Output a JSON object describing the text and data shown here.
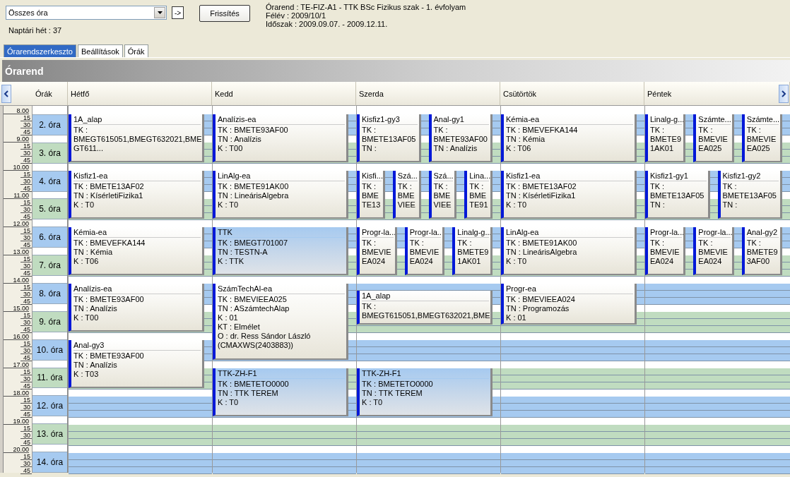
{
  "filter": {
    "value": "Összes óra",
    "go_button": "->"
  },
  "week": "Naptári hét : 37",
  "refresh_button": "Frissítés",
  "info": [
    "Órarend : TE-FIZ-A1 - TTK BSc Fizikus szak - 1. évfolyam",
    "Félév : 2009/10/1",
    "Időszak : 2009.09.07. - 2009.12.11."
  ],
  "tabs": [
    {
      "label": "Órarendszerkeszto",
      "selected": true
    },
    {
      "label": "Beállítások",
      "selected": false
    },
    {
      "label": "Órák",
      "selected": false
    }
  ],
  "panel_title": "Órarend",
  "periods_header": "Órák",
  "hours": [
    {
      "label": "8.00",
      "marks": [
        "15",
        "30",
        "45"
      ]
    },
    {
      "label": "9.00",
      "marks": [
        "15",
        "30",
        "45"
      ]
    },
    {
      "label": "10.00",
      "marks": [
        "15",
        "30",
        "45"
      ]
    },
    {
      "label": "11.00",
      "marks": [
        "15",
        "30",
        "45"
      ]
    },
    {
      "label": "12.00",
      "marks": [
        "15",
        "30",
        "45"
      ]
    },
    {
      "label": "13.00",
      "marks": [
        "15",
        "30",
        "45"
      ]
    },
    {
      "label": "14.00",
      "marks": [
        "15",
        "30",
        "45"
      ]
    },
    {
      "label": "15.00",
      "marks": [
        "15",
        "30",
        "45"
      ]
    },
    {
      "label": "16.00",
      "marks": [
        "15",
        "30",
        "45"
      ]
    },
    {
      "label": "17.00",
      "marks": [
        "15",
        "30",
        "45"
      ]
    },
    {
      "label": "18.00",
      "marks": [
        "15",
        "30",
        "45"
      ]
    },
    {
      "label": "19.00",
      "marks": [
        "15",
        "30",
        "45"
      ]
    },
    {
      "label": "20.00",
      "marks": [
        "15",
        "30",
        "45"
      ]
    }
  ],
  "periods": [
    {
      "label": "2. óra",
      "color": "#a6caf0"
    },
    {
      "label": "3. óra",
      "color": "#c0dcc0"
    },
    {
      "label": "4. óra",
      "color": "#a6caf0"
    },
    {
      "label": "5. óra",
      "color": "#c0dcc0"
    },
    {
      "label": "6. óra",
      "color": "#a6caf0"
    },
    {
      "label": "7. óra",
      "color": "#c0dcc0"
    },
    {
      "label": "8. óra",
      "color": "#a6caf0"
    },
    {
      "label": "9. óra",
      "color": "#c0dcc0"
    },
    {
      "label": "10. óra",
      "color": "#a6caf0"
    },
    {
      "label": "11. óra",
      "color": "#c0dcc0"
    },
    {
      "label": "12. óra",
      "color": "#a6caf0"
    },
    {
      "label": "13. óra",
      "color": "#c0dcc0"
    },
    {
      "label": "14. óra",
      "color": "#a6caf0"
    }
  ],
  "days": [
    {
      "name": "Hétfő",
      "groups": [
        {
          "events": [
            {
              "title": "1A_alap",
              "highlighted": false,
              "lines": [
                "TK :",
                "BMEGT615051,BMEGT632021,BME",
                "GT611..."
              ]
            }
          ]
        },
        {
          "events": [
            {
              "title": "Kisfiz1-ea",
              "highlighted": false,
              "lines": [
                "TK : BMETE13AF02",
                "TN : KísérletiFizika1",
                "K : T0"
              ]
            }
          ]
        },
        {
          "events": [
            {
              "title": "Kémia-ea",
              "highlighted": false,
              "lines": [
                "TK : BMEVEFKA144",
                "TN : Kémia",
                "K : T06"
              ]
            }
          ]
        },
        {
          "events": [
            {
              "title": "Analízis-ea",
              "highlighted": false,
              "lines": [
                "TK : BMETE93AF00",
                "TN : Analízis",
                "K : T00"
              ]
            }
          ]
        },
        {
          "events": [
            {
              "title": "Anal-gy3",
              "highlighted": false,
              "lines": [
                "TK : BMETE93AF00",
                "TN : Analízis",
                "K : T03"
              ]
            }
          ]
        }
      ]
    },
    {
      "name": "Kedd",
      "groups": [
        {
          "events": [
            {
              "title": "Analízis-ea",
              "highlighted": false,
              "lines": [
                "TK : BMETE93AF00",
                "TN : Analízis",
                "K : T00"
              ]
            }
          ]
        },
        {
          "events": [
            {
              "title": "LinAlg-ea",
              "highlighted": false,
              "lines": [
                "TK : BMETE91AK00",
                "TN : LineárisAlgebra",
                "K : T0"
              ]
            }
          ]
        },
        {
          "events": [
            {
              "title": "TTK",
              "highlighted": true,
              "lines": [
                "TK : BMEGT701007",
                "TN : TESTN-A",
                "K : TTK"
              ]
            }
          ]
        },
        {
          "events": [
            {
              "title": "SzámTechAl-ea",
              "highlighted": false,
              "lines": [
                "TK : BMEVIEEA025",
                "TN : ASzámtechAlap",
                "K : 01",
                "KT : Elmélet",
                "O :  dr. Ress Sándor László",
                "(CMAXWS(2403883))"
              ]
            }
          ]
        },
        {
          "events": [
            {
              "title": "TTK-ZH-F1",
              "highlighted": true,
              "lines": [
                "TK : BMETETO0000",
                "TN : TTK TEREM",
                "K : T0"
              ]
            }
          ]
        }
      ]
    },
    {
      "name": "Szerda",
      "groups": [
        {
          "events": [
            {
              "title": "Kisfiz1-gy3",
              "highlighted": false,
              "lines": [
                "TK :",
                "BMETE13AF05",
                "TN :"
              ]
            },
            {
              "title": "Anal-gy1",
              "highlighted": false,
              "lines": [
                "TK :",
                "BMETE93AF00",
                "TN : Analízis"
              ]
            }
          ]
        },
        {
          "events": [
            {
              "title": "Kisfi...",
              "highlighted": false,
              "lines": [
                "TK :",
                "BME",
                "TE13"
              ]
            },
            {
              "title": "Szá...",
              "highlighted": false,
              "lines": [
                "TK :",
                "BME",
                "VIEE"
              ]
            },
            {
              "title": "Szá...",
              "highlighted": false,
              "lines": [
                "TK :",
                "BME",
                "VIEE"
              ]
            },
            {
              "title": "Lina...",
              "highlighted": false,
              "lines": [
                "TK :",
                "BME",
                "TE91"
              ]
            }
          ]
        },
        {
          "events": [
            {
              "title": "Progr-la...",
              "highlighted": false,
              "lines": [
                "TK :",
                "BMEVIE",
                "EA024"
              ]
            },
            {
              "title": "Progr-la...",
              "highlighted": false,
              "lines": [
                "TK :",
                "BMEVIE",
                "EA024"
              ]
            },
            {
              "title": "Linalg-g...",
              "highlighted": false,
              "lines": [
                "TK :",
                "BMETE9",
                "1AK01"
              ]
            }
          ]
        },
        {
          "events": [
            {
              "title": "1A_alap",
              "highlighted": false,
              "lines": [
                "TK :",
                "BMEGT615051,BMEGT632021,BME"
              ]
            }
          ]
        },
        {
          "events": [
            {
              "title": "TTK-ZH-F1",
              "highlighted": true,
              "lines": [
                "TK : BMETETO0000",
                "TN : TTK TEREM",
                "K : T0"
              ]
            }
          ]
        }
      ]
    },
    {
      "name": "Csütörtök",
      "groups": [
        {
          "events": [
            {
              "title": "Kémia-ea",
              "highlighted": false,
              "lines": [
                "TK : BMEVEFKA144",
                "TN : Kémia",
                "K : T06"
              ]
            }
          ]
        },
        {
          "events": [
            {
              "title": "Kisfiz1-ea",
              "highlighted": false,
              "lines": [
                "TK : BMETE13AF02",
                "TN : KísérletiFizika1",
                "K : T0"
              ]
            }
          ]
        },
        {
          "events": [
            {
              "title": "LinAlg-ea",
              "highlighted": false,
              "lines": [
                "TK : BMETE91AK00",
                "TN : LineárisAlgebra",
                "K : T0"
              ]
            }
          ]
        },
        {
          "events": [
            {
              "title": "Progr-ea",
              "highlighted": false,
              "lines": [
                "TK : BMEVIEEA024",
                "TN : Programozás",
                "K : 01"
              ]
            }
          ]
        }
      ]
    },
    {
      "name": "Péntek",
      "groups": [
        {
          "events": [
            {
              "title": "Linalg-g...",
              "highlighted": false,
              "lines": [
                "TK :",
                "BMETE9",
                "1AK01"
              ]
            },
            {
              "title": "Számte...",
              "highlighted": false,
              "lines": [
                "TK :",
                "BMEVIE",
                "EA025"
              ]
            },
            {
              "title": "Számte...",
              "highlighted": false,
              "lines": [
                "TK :",
                "BMEVIE",
                "EA025"
              ]
            }
          ]
        },
        {
          "events": [
            {
              "title": "Kisfiz1-gy1",
              "highlighted": false,
              "lines": [
                "TK :",
                "BMETE13AF05",
                "TN :"
              ]
            },
            {
              "title": "Kisfiz1-gy2",
              "highlighted": false,
              "lines": [
                "TK :",
                "BMETE13AF05",
                "TN :"
              ]
            }
          ]
        },
        {
          "events": [
            {
              "title": "Progr-la...",
              "highlighted": false,
              "lines": [
                "TK :",
                "BMEVIE",
                "EA024"
              ]
            },
            {
              "title": "Progr-la...",
              "highlighted": false,
              "lines": [
                "TK :",
                "BMEVIE",
                "EA024"
              ]
            },
            {
              "title": "Anal-gy2",
              "highlighted": false,
              "lines": [
                "TK :",
                "BMETE9",
                "3AF00"
              ]
            }
          ]
        }
      ]
    }
  ]
}
